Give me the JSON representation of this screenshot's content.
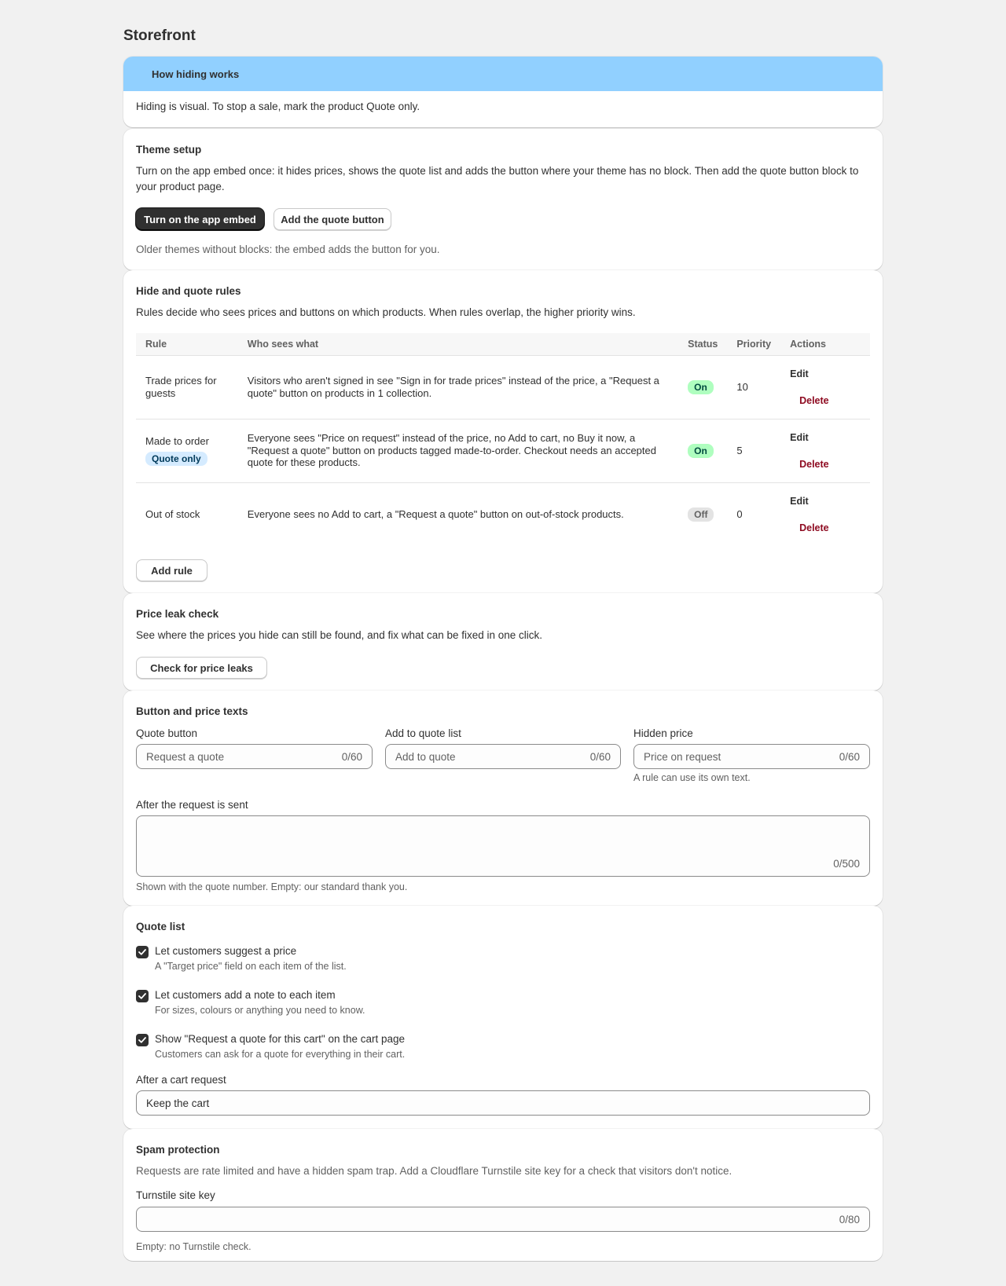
{
  "page": {
    "title": "Storefront"
  },
  "banner": {
    "title": "How hiding works",
    "text": "Hiding is visual. To stop a sale, mark the product Quote only."
  },
  "theme_setup": {
    "title": "Theme setup",
    "text": "Turn on the app embed once: it hides prices, shows the quote list and adds the button where your theme has no block. Then add the quote button block to your product page.",
    "primary_button": "Turn on the app embed",
    "secondary_button": "Add the quote button",
    "footnote": "Older themes without blocks: the embed adds the button for you."
  },
  "rules": {
    "title": "Hide and quote rules",
    "text": "Rules decide who sees prices and buttons on which products. When rules overlap, the higher priority wins.",
    "columns": [
      "Rule",
      "Who sees what",
      "Status",
      "Priority",
      "Actions"
    ],
    "rows": [
      {
        "rule": "Trade prices for guests",
        "badge": "",
        "who": "Visitors who aren't signed in see \"Sign in for trade prices\" instead of the price, a \"Request a quote\" button on products in 1 collection.",
        "status": "On",
        "priority": "10",
        "edit": "Edit",
        "delete": "Delete"
      },
      {
        "rule": "Made to order",
        "badge": "Quote only",
        "who": "Everyone sees \"Price on request\" instead of the price, no Add to cart, no Buy it now, a \"Request a quote\" button on products tagged made-to-order. Checkout needs an accepted quote for these products.",
        "status": "On",
        "priority": "5",
        "edit": "Edit",
        "delete": "Delete"
      },
      {
        "rule": "Out of stock",
        "badge": "",
        "who": "Everyone sees no Add to cart, a \"Request a quote\" button on out-of-stock products.",
        "status": "Off",
        "priority": "0",
        "edit": "Edit",
        "delete": "Delete"
      }
    ],
    "add_button": "Add rule"
  },
  "price_leak": {
    "title": "Price leak check",
    "text": "See where the prices you hide can still be found, and fix what can be fixed in one click.",
    "button": "Check for price leaks"
  },
  "texts": {
    "title": "Button and price texts",
    "quote_button": {
      "label": "Quote button",
      "placeholder": "Request a quote",
      "count": "0/60"
    },
    "add_to_list": {
      "label": "Add to quote list",
      "placeholder": "Add to quote",
      "count": "0/60"
    },
    "hidden_price": {
      "label": "Hidden price",
      "placeholder": "Price on request",
      "count": "0/60",
      "help": "A rule can use its own text."
    },
    "after_sent": {
      "label": "After the request is sent",
      "count": "0/500",
      "help": "Shown with the quote number. Empty: our standard thank you."
    }
  },
  "quote_list": {
    "title": "Quote list",
    "options": [
      {
        "label": "Let customers suggest a price",
        "help": "A \"Target price\" field on each item of the list.",
        "checked": true
      },
      {
        "label": "Let customers add a note to each item",
        "help": "For sizes, colours or anything you need to know.",
        "checked": true
      },
      {
        "label": "Show \"Request a quote for this cart\" on the cart page",
        "help": "Customers can ask for a quote for everything in their cart.",
        "checked": true
      }
    ],
    "after_cart": {
      "label": "After a cart request",
      "value": "Keep the cart"
    }
  },
  "spam": {
    "title": "Spam protection",
    "text": "Requests are rate limited and have a hidden spam trap. Add a Cloudflare Turnstile site key for a check that visitors don't notice.",
    "field_label": "Turnstile site key",
    "count": "0/80",
    "help": "Empty: no Turnstile check."
  },
  "colors": {
    "banner": "#91d0ff",
    "primary": "#303030",
    "badge_on": "#affebf",
    "badge_off": "#e3e3e3",
    "badge_info": "#d5ebff",
    "delete": "#8e0b21"
  }
}
